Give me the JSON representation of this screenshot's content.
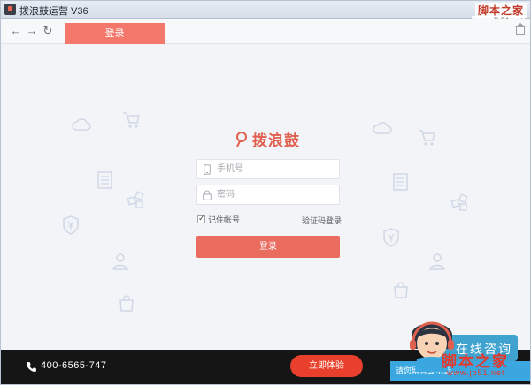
{
  "window": {
    "title": "拨浪鼓运营 V36",
    "minimize_glyph": "—",
    "close_glyph": "✕"
  },
  "watermark": {
    "top_text": "脚本之家",
    "top_url": "www.Jb51.net",
    "bottom_text": "脚本之家",
    "bottom_url": "www.jb51.net"
  },
  "toolbar": {
    "back_glyph": "←",
    "forward_glyph": "→",
    "refresh_glyph": "↻",
    "active_tab": "登录"
  },
  "login": {
    "logo_text": "拨浪鼓",
    "phone_placeholder": "手机号",
    "password_placeholder": "密码",
    "remember_label": "记住帐号",
    "remember_checked": true,
    "sms_login": "验证码登录",
    "submit_label": "登录"
  },
  "footer": {
    "phone": "400-6565-747",
    "trial_label": "立即体验"
  },
  "consult": {
    "title": "在线咨询",
    "bar_text": "请您留言或电话..."
  },
  "colors": {
    "accent": "#ea6c5e",
    "tab": "#f3786b",
    "logo": "#e0604f",
    "footer": "#151515",
    "trial": "#e8402c",
    "consult": "#3fa2cf",
    "deco_icon": "#cfd8e6"
  },
  "decorative_icons": [
    "cloud-icon",
    "cart-icon",
    "document-icon",
    "blocks-icon",
    "shield-yen-icon",
    "user-icon",
    "bag-icon"
  ]
}
